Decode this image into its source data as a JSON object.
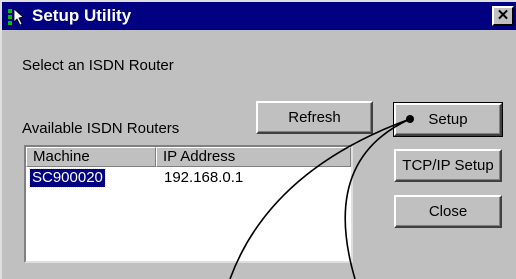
{
  "window": {
    "title": "Setup Utility",
    "close_glyph": "✕"
  },
  "labels": {
    "select_prompt": "Select an ISDN Router",
    "available_routers": "Available ISDN Routers"
  },
  "buttons": {
    "refresh": "Refresh",
    "setup": "Setup",
    "tcpip_setup": "TCP/IP Setup",
    "close": "Close"
  },
  "list": {
    "columns": [
      "Machine",
      "IP Address"
    ],
    "rows": [
      {
        "machine": "SC900020",
        "ip": "192.168.0.1",
        "selected": true
      }
    ]
  },
  "colors": {
    "titlebar": "#000080",
    "window_bg": "#c0c0c0",
    "selection": "#000080"
  },
  "icons": {
    "app": "setup-utility-icon",
    "close": "close-icon"
  }
}
